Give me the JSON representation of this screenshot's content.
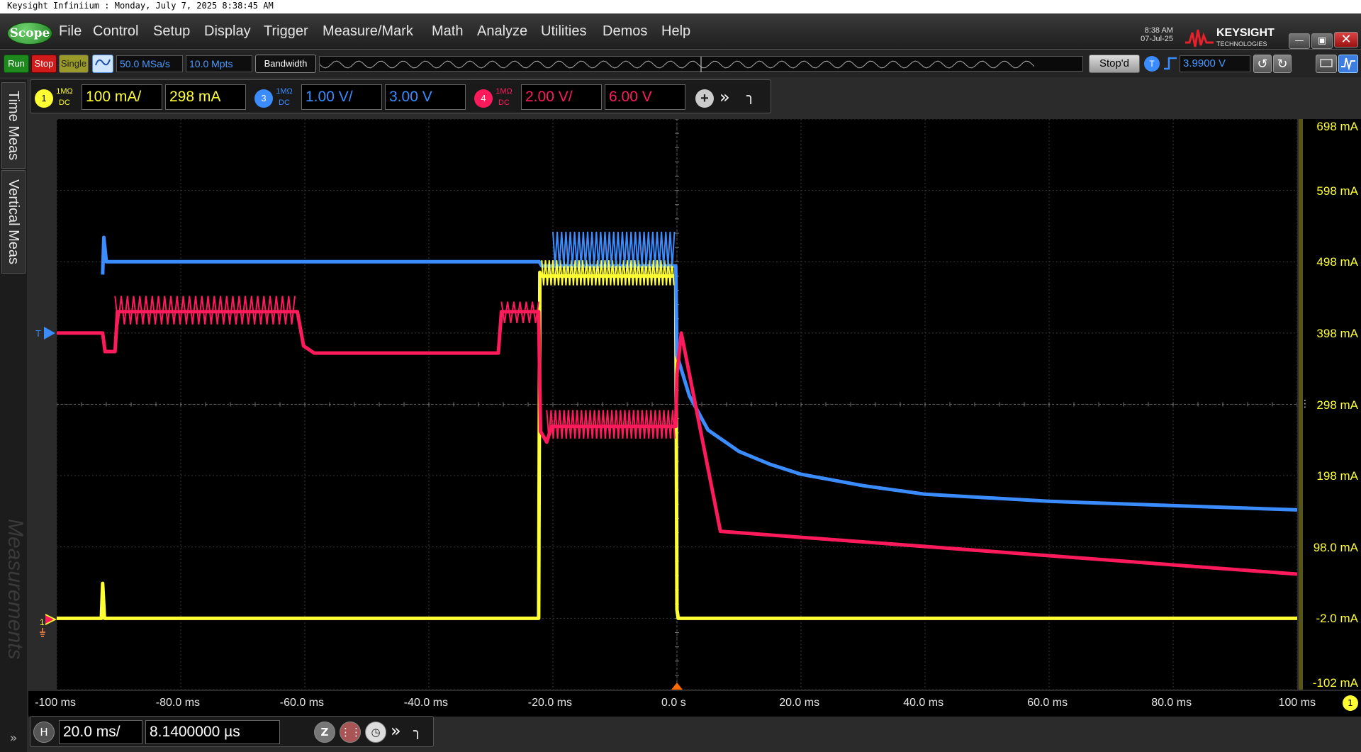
{
  "window": {
    "title": "Keysight Infiniium : Monday, July 7, 2025 8:38:45 AM"
  },
  "menubar": {
    "scope_label": "Scope",
    "items": [
      "File",
      "Control",
      "Setup",
      "Display",
      "Trigger",
      "Measure/Mark",
      "Math",
      "Analyze",
      "Utilities",
      "Demos",
      "Help"
    ],
    "time": "8:38 AM",
    "date": "07-Jul-25",
    "brand_name": "KEYSIGHT",
    "brand_sub": "TECHNOLOGIES",
    "minimize_icon": "minimize-icon",
    "restore_icon": "restore-icon",
    "close_icon": "close-icon"
  },
  "toolbar": {
    "run_label": "Run",
    "stop_label": "Stop",
    "single_label": "Single",
    "sample_rate": "50.0 MSa/s",
    "memory_depth": "10.0 Mpts",
    "bandwidth_label": "Bandwidth",
    "status": "Stop'd",
    "trigger_badge": "T",
    "trigger_level": "3.9900 V",
    "colors": {
      "run": "#1e8a1e",
      "stop": "#d11a1a",
      "single": "#9a9a2a"
    }
  },
  "channels": [
    {
      "number": "1",
      "coupling_top": "1MΩ",
      "coupling_bottom": "DC",
      "scale": "100 mA/",
      "offset": "298 mA",
      "color": "#ffff33"
    },
    {
      "number": "3",
      "coupling_top": "1MΩ",
      "coupling_bottom": "DC",
      "scale": "1.00 V/",
      "offset": "3.00 V",
      "color": "#3b8cff"
    },
    {
      "number": "4",
      "coupling_top": "1MΩ",
      "coupling_bottom": "DC",
      "scale": "2.00 V/",
      "offset": "6.00 V",
      "color": "#ff1a5c"
    }
  ],
  "sidetabs": {
    "time_meas": "Time Meas",
    "vertical_meas": "Vertical Meas",
    "measurements": "Measurements"
  },
  "markers": {
    "trigger": "T",
    "ground": "1"
  },
  "horizontal": {
    "badge": "H",
    "scale": "20.0 ms/",
    "position": "8.1400000 µs"
  },
  "bottom_right_badge": "1",
  "chart_data": {
    "type": "line",
    "title": "",
    "xlabel": "",
    "ylabel": "",
    "x_ticks": [
      "-100 ms",
      "-80.0 ms",
      "-60.0 ms",
      "-40.0 ms",
      "-20.0 ms",
      "0.0 s",
      "20.0 ms",
      "40.0 ms",
      "60.0 ms",
      "80.0 ms",
      "100 ms"
    ],
    "y_ticks": [
      "698 mA",
      "598 mA",
      "498 mA",
      "398 mA",
      "298 mA",
      "198 mA",
      "98.0 mA",
      "-2.0 mA",
      "-102 mA"
    ],
    "xlim": [
      -100,
      100
    ],
    "ylim": [
      -102,
      698
    ],
    "grid": true,
    "series": [
      {
        "color": "#ffff33",
        "x": [
          -100,
          -92.8,
          -92.6,
          -92.3,
          -22.3,
          -22.1,
          -21.9,
          -0.2,
          0.0,
          0.2,
          100
        ],
        "y": [
          -2,
          -2,
          47,
          -2,
          -2,
          483,
          478,
          478,
          10,
          -2,
          -2
        ]
      },
      {
        "color": "#3b8cff",
        "x": [
          -92.6,
          -92.4,
          -92.0,
          -22.2,
          -21.8,
          -0.2,
          0.0,
          2,
          5,
          10,
          15,
          20,
          30,
          40,
          60,
          80,
          100
        ],
        "y": [
          480,
          532,
          498,
          498,
          492,
          492,
          367,
          310,
          262,
          232,
          214,
          200,
          184,
          172,
          162,
          156,
          150
        ]
      },
      {
        "color": "#ff1a5c",
        "x": [
          -100,
          -92.6,
          -92.2,
          -90.6,
          -90.2,
          -61.2,
          -60.2,
          -58.5,
          -28.8,
          -28.3,
          -22.3,
          -22.0,
          -21.0,
          -20.2,
          -0.2,
          0.0,
          0.7,
          7,
          100
        ],
        "y": [
          398,
          398,
          372,
          372,
          428,
          428,
          380,
          370,
          370,
          428,
          428,
          260,
          245,
          267,
          267,
          340,
          398,
          120,
          60
        ]
      }
    ]
  }
}
